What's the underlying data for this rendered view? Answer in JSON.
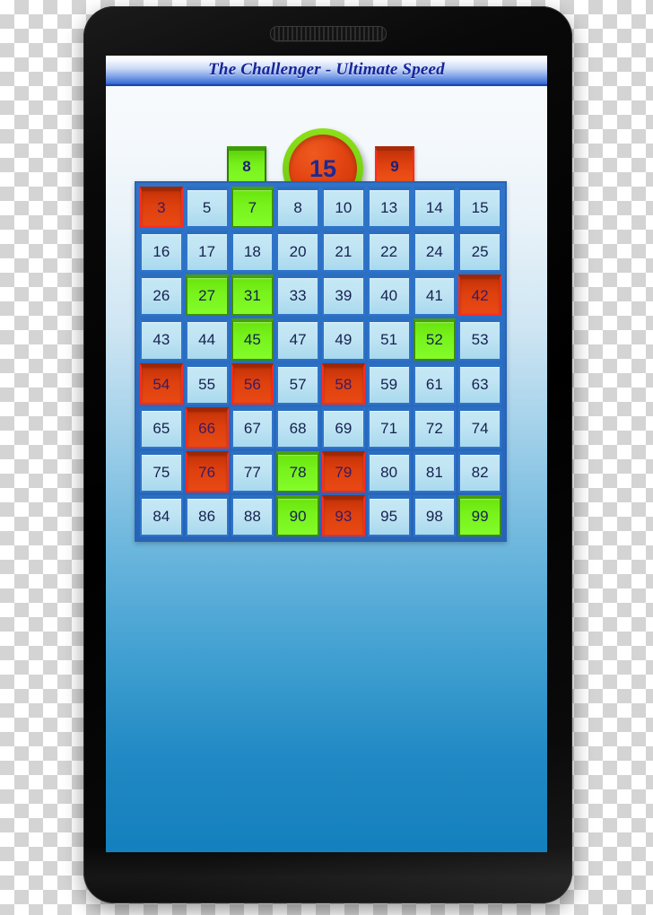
{
  "app": {
    "title": "The Challenger - Ultimate Speed"
  },
  "scoreboard": {
    "left_score": "8",
    "center_target": "15",
    "right_score": "9"
  },
  "colors": {
    "title_text": "#16249a",
    "titlebar_accent": "#3e6fd6",
    "cell_normal_bg": "#bfe4f3",
    "cell_normal_border": "#2f74c9",
    "cell_green_bg": "#77f21b",
    "cell_green_border": "#3c8c07",
    "cell_red_bg": "#dd3f0e",
    "cell_red_border": "#ff2a20",
    "grid_frame": "#2a6cc0",
    "screen_bottom": "#1380bd",
    "device_body": "#000000"
  },
  "grid": {
    "rows": 8,
    "cols": 8,
    "cells": [
      {
        "value": "3",
        "state": "red"
      },
      {
        "value": "5",
        "state": "normal"
      },
      {
        "value": "7",
        "state": "green"
      },
      {
        "value": "8",
        "state": "normal"
      },
      {
        "value": "10",
        "state": "normal"
      },
      {
        "value": "13",
        "state": "normal"
      },
      {
        "value": "14",
        "state": "normal"
      },
      {
        "value": "15",
        "state": "normal"
      },
      {
        "value": "16",
        "state": "normal"
      },
      {
        "value": "17",
        "state": "normal"
      },
      {
        "value": "18",
        "state": "normal"
      },
      {
        "value": "20",
        "state": "normal"
      },
      {
        "value": "21",
        "state": "normal"
      },
      {
        "value": "22",
        "state": "normal"
      },
      {
        "value": "24",
        "state": "normal"
      },
      {
        "value": "25",
        "state": "normal"
      },
      {
        "value": "26",
        "state": "normal"
      },
      {
        "value": "27",
        "state": "green"
      },
      {
        "value": "31",
        "state": "green"
      },
      {
        "value": "33",
        "state": "normal"
      },
      {
        "value": "39",
        "state": "normal"
      },
      {
        "value": "40",
        "state": "normal"
      },
      {
        "value": "41",
        "state": "normal"
      },
      {
        "value": "42",
        "state": "red"
      },
      {
        "value": "43",
        "state": "normal"
      },
      {
        "value": "44",
        "state": "normal"
      },
      {
        "value": "45",
        "state": "green"
      },
      {
        "value": "47",
        "state": "normal"
      },
      {
        "value": "49",
        "state": "normal"
      },
      {
        "value": "51",
        "state": "normal"
      },
      {
        "value": "52",
        "state": "green"
      },
      {
        "value": "53",
        "state": "normal"
      },
      {
        "value": "54",
        "state": "red"
      },
      {
        "value": "55",
        "state": "normal"
      },
      {
        "value": "56",
        "state": "red"
      },
      {
        "value": "57",
        "state": "normal"
      },
      {
        "value": "58",
        "state": "red"
      },
      {
        "value": "59",
        "state": "normal"
      },
      {
        "value": "61",
        "state": "normal"
      },
      {
        "value": "63",
        "state": "normal"
      },
      {
        "value": "65",
        "state": "normal"
      },
      {
        "value": "66",
        "state": "red"
      },
      {
        "value": "67",
        "state": "normal"
      },
      {
        "value": "68",
        "state": "normal"
      },
      {
        "value": "69",
        "state": "normal"
      },
      {
        "value": "71",
        "state": "normal"
      },
      {
        "value": "72",
        "state": "normal"
      },
      {
        "value": "74",
        "state": "normal"
      },
      {
        "value": "75",
        "state": "normal"
      },
      {
        "value": "76",
        "state": "red"
      },
      {
        "value": "77",
        "state": "normal"
      },
      {
        "value": "78",
        "state": "green"
      },
      {
        "value": "79",
        "state": "red"
      },
      {
        "value": "80",
        "state": "normal"
      },
      {
        "value": "81",
        "state": "normal"
      },
      {
        "value": "82",
        "state": "normal"
      },
      {
        "value": "84",
        "state": "normal"
      },
      {
        "value": "86",
        "state": "normal"
      },
      {
        "value": "88",
        "state": "normal"
      },
      {
        "value": "90",
        "state": "green"
      },
      {
        "value": "93",
        "state": "red"
      },
      {
        "value": "95",
        "state": "normal"
      },
      {
        "value": "98",
        "state": "normal"
      },
      {
        "value": "99",
        "state": "green"
      }
    ]
  }
}
